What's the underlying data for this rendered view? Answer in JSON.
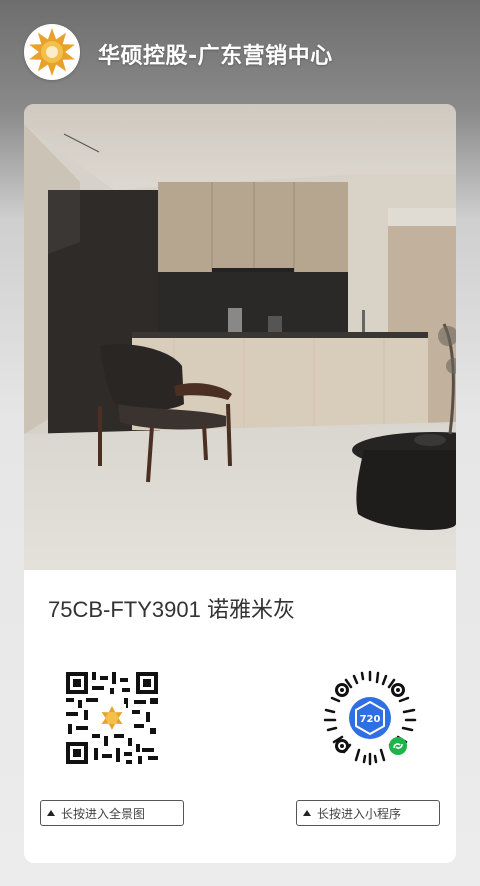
{
  "header": {
    "title": "华硕控股-广东营销中心",
    "logo_icon": "sun-logo-icon"
  },
  "product": {
    "name": "75CB-FTY3901 诺雅米灰"
  },
  "actions": {
    "panorama_label": "长按进入全景图",
    "miniprogram_label": "长按进入小程序",
    "miniprogram_badge": "720"
  },
  "colors": {
    "header_text": "#ffffff",
    "logo_orange": "#e8a12a",
    "mini_program_blue": "#2f6fe4",
    "mini_program_green": "#1fb44a"
  }
}
